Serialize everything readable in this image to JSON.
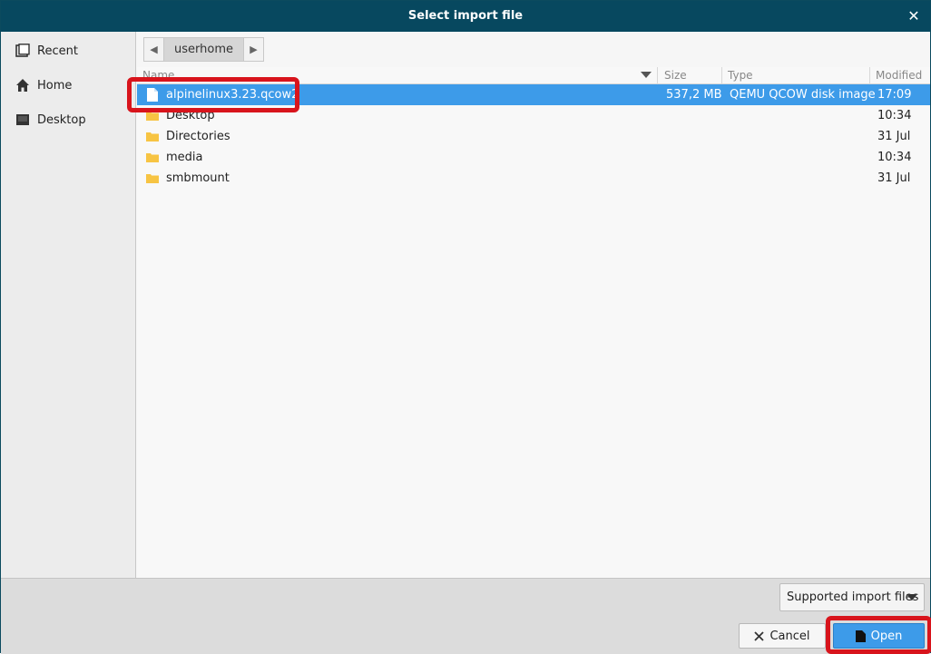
{
  "window": {
    "title": "Select import file",
    "close_glyph": "✕"
  },
  "sidebar": {
    "items": [
      {
        "label": "Recent",
        "icon": "recent-icon"
      },
      {
        "label": "Home",
        "icon": "home-icon"
      },
      {
        "label": "Desktop",
        "icon": "desktop-icon"
      }
    ]
  },
  "pathbar": {
    "back_glyph": "◀",
    "forward_glyph": "▶",
    "segment": "userhome"
  },
  "filelist": {
    "columns": {
      "name": "Name",
      "size": "Size",
      "type": "Type",
      "modified": "Modified"
    },
    "rows": [
      {
        "name": "alpinelinux3.23.qcow2",
        "size": "537,2 MB",
        "type": "QEMU QCOW disk image",
        "modified": "17:09",
        "kind": "file",
        "selected": true
      },
      {
        "name": "Desktop",
        "size": "",
        "type": "",
        "modified": "10:34",
        "kind": "folder",
        "selected": false
      },
      {
        "name": "Directories",
        "size": "",
        "type": "",
        "modified": "31 Jul",
        "kind": "folder",
        "selected": false
      },
      {
        "name": "media",
        "size": "",
        "type": "",
        "modified": "10:34",
        "kind": "folder",
        "selected": false
      },
      {
        "name": "smbmount",
        "size": "",
        "type": "",
        "modified": "31 Jul",
        "kind": "folder",
        "selected": false
      }
    ]
  },
  "footer": {
    "filter_label": "Supported import files",
    "cancel_label": "Cancel",
    "open_label": "Open"
  },
  "colors": {
    "titlebar": "#07485f",
    "selection": "#3d9be9",
    "highlight": "#d8141c",
    "folder": "#f7c443"
  }
}
